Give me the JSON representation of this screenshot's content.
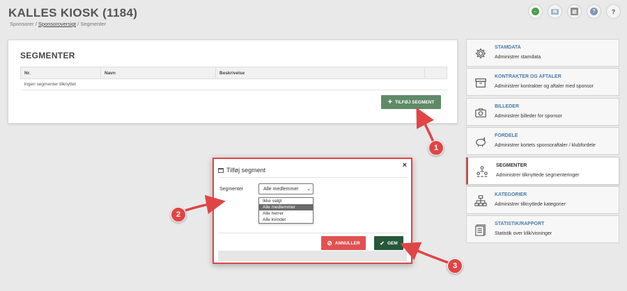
{
  "header": {
    "title": "KALLES KIOSK (1184)",
    "breadcrumb": {
      "root": "Sponsorer",
      "sep": "/",
      "link": "Sponsoroversigt",
      "current": "Segmenter"
    }
  },
  "top_icons": [
    {
      "name": "back-icon",
      "color": "#4aa04a"
    },
    {
      "name": "mail-icon",
      "color": "#9bb3cc"
    },
    {
      "name": "document-icon",
      "color": "#8c8c8c"
    },
    {
      "name": "help-circle-icon",
      "color": "#7d95b6"
    },
    {
      "name": "question-icon",
      "color": "#555555"
    }
  ],
  "segments_panel": {
    "title": "SEGMENTER",
    "columns": [
      "Nr.",
      "Navn",
      "Beskrivelse",
      ""
    ],
    "empty_text": "Ingen segmenter tilknyttet",
    "add_button": "TILFØJ SEGMENT"
  },
  "menu": [
    {
      "icon": "gear-icon",
      "title": "STAMDATA",
      "desc": "Administrer stamdata",
      "active": false
    },
    {
      "icon": "archive-icon",
      "title": "KONTRAKTER OG AFTALER",
      "desc": "Administrer kontrakter og aftaler med sponsor",
      "active": false
    },
    {
      "icon": "camera-icon",
      "title": "BILLEDER",
      "desc": "Administrer billeder for sponsor",
      "active": false
    },
    {
      "icon": "piggy-bank-icon",
      "title": "FORDELE",
      "desc": "Administrer kortets sponsoraftaler / klubfordele",
      "active": false
    },
    {
      "icon": "people-icon",
      "title": "SEGMENTER",
      "desc": "Administrer tilknyttede segmenteringer",
      "active": true
    },
    {
      "icon": "hierarchy-icon",
      "title": "KATEGORIER",
      "desc": "Administrer tilknyttede kategorier",
      "active": false
    },
    {
      "icon": "report-icon",
      "title": "STATISTIK/RAPPORT",
      "desc": "Statistik over klik/visninger",
      "active": false
    }
  ],
  "modal": {
    "title": "Tilføj segment",
    "close": "×",
    "field_label": "Segmenter",
    "selected": "Alle medlemmer",
    "options": [
      "Ikke valgt",
      "Alle medlemmer",
      "Alle herrer",
      "Alle kvinder"
    ],
    "cancel_label": "ANNULLER",
    "save_label": "GEM"
  },
  "callouts": [
    "1",
    "2",
    "3"
  ],
  "colors": {
    "accent_green": "#5f8a67",
    "save_green": "#25583a",
    "cancel_red": "#e05252",
    "annotation_red": "#e04545",
    "link_blue": "#4b7aa6"
  }
}
